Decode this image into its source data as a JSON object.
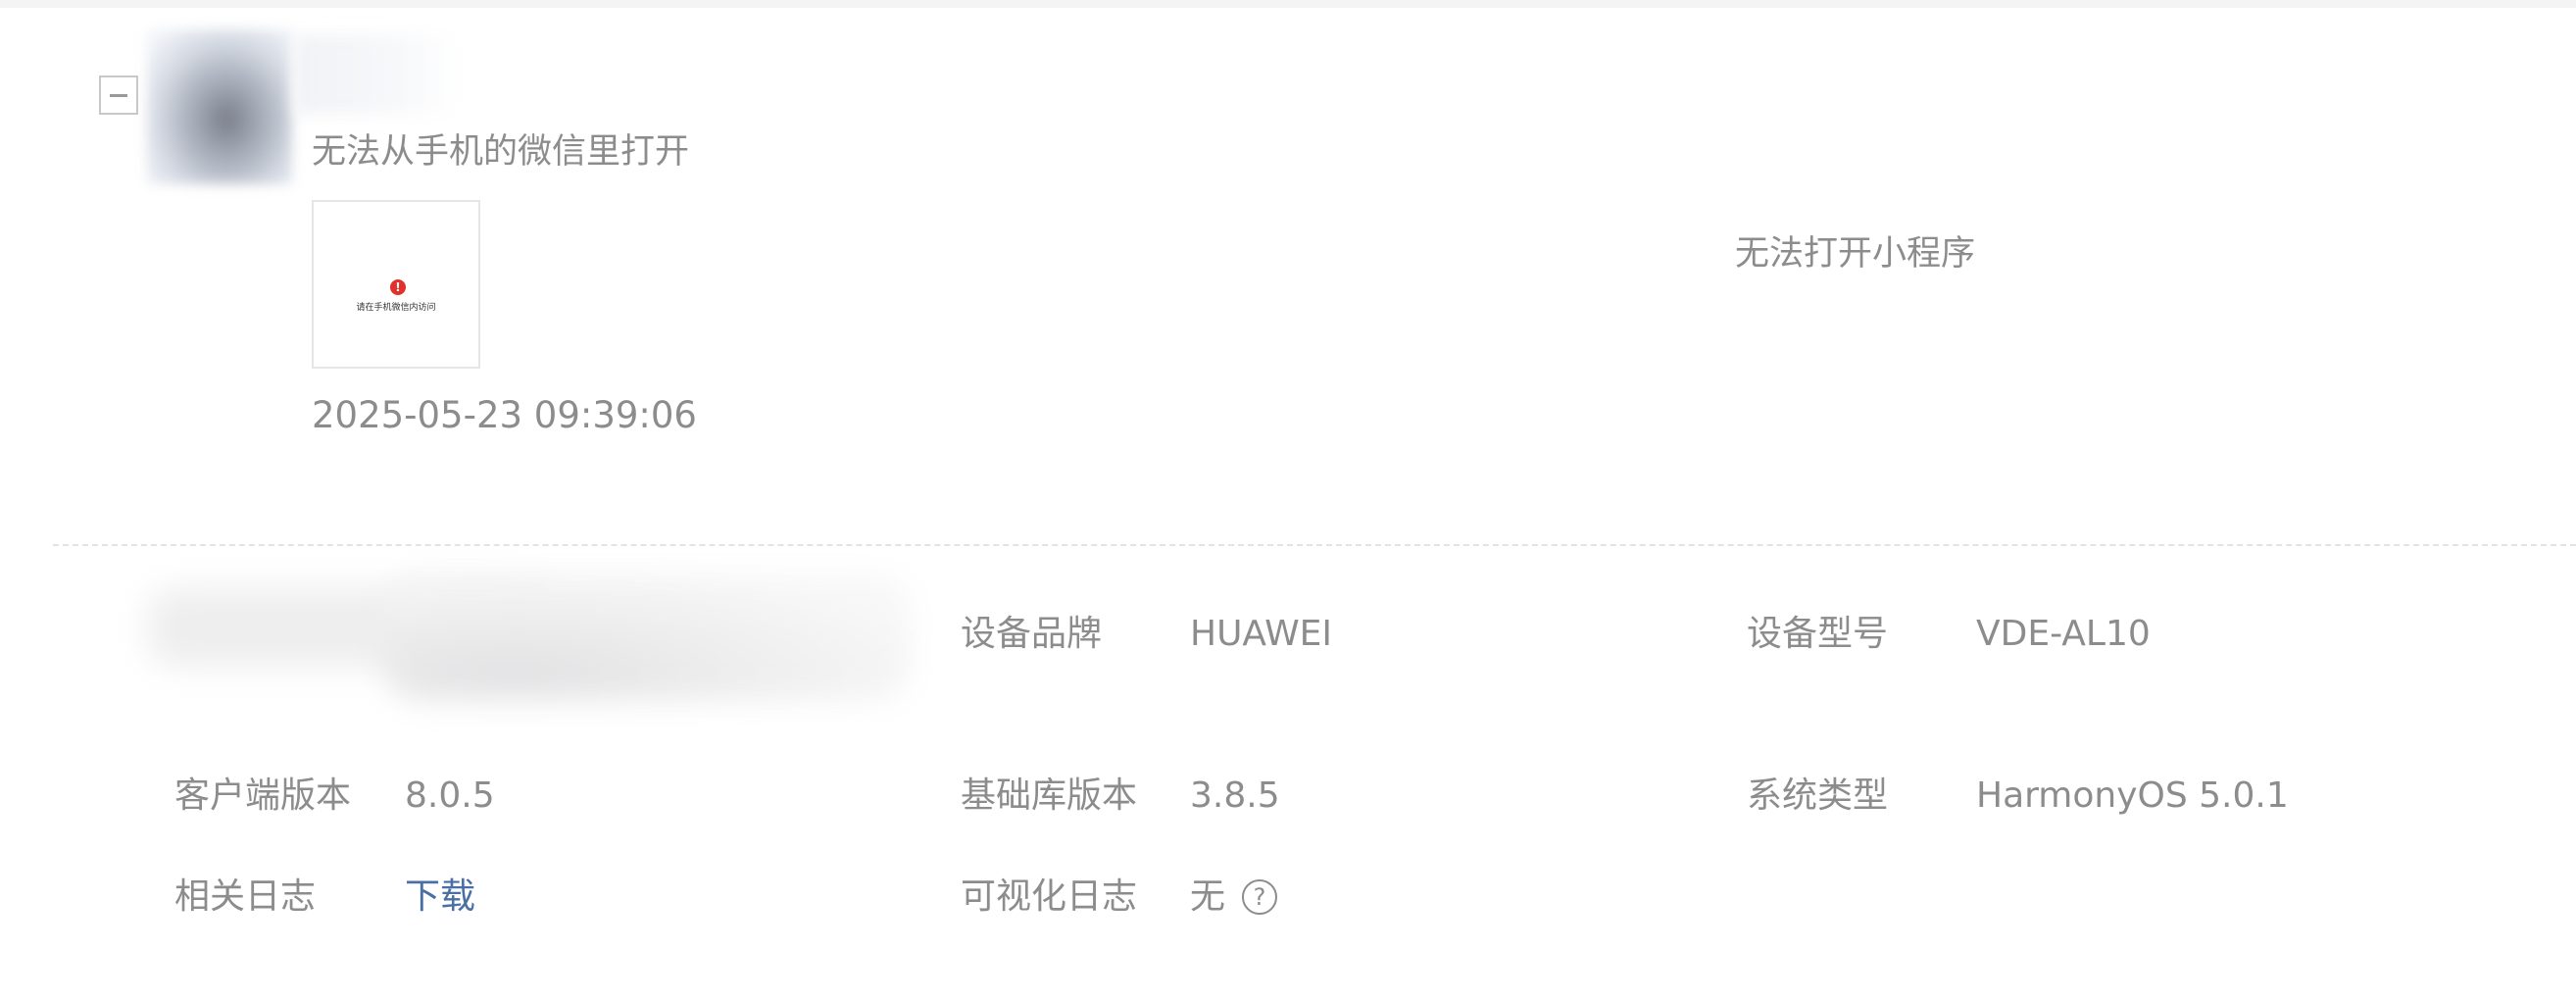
{
  "feedback": {
    "title": "无法从手机的微信里打开",
    "screenshot_text": "请在手机微信内访问",
    "time": "2025-05-23 09:39:06",
    "category": "无法打开小程序"
  },
  "collapse_symbol": "−",
  "error_symbol": "!",
  "device": {
    "brand_label": "设备品牌",
    "brand_value": "HUAWEI",
    "model_label": "设备型号",
    "model_value": "VDE-AL10",
    "client_version_label": "客户端版本",
    "client_version_value": "8.0.5",
    "base_lib_label": "基础库版本",
    "base_lib_value": "3.8.5",
    "os_label": "系统类型",
    "os_value": "HarmonyOS 5.0.1",
    "logs_label": "相关日志",
    "logs_link": "下载",
    "visual_logs_label": "可视化日志",
    "visual_logs_value": "无",
    "help_symbol": "?"
  },
  "colors": {
    "text_gray": "#8c8c8c",
    "link_blue": "#4a6fa5",
    "error_red": "#e0312b",
    "divider": "#e3e3e3"
  },
  "icons": [
    "collapse-icon",
    "error-icon",
    "help-icon"
  ]
}
